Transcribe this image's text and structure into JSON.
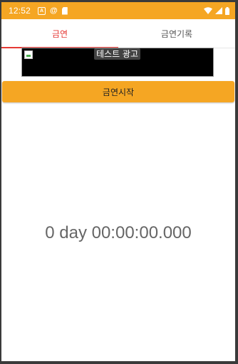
{
  "status_bar": {
    "time": "12:52",
    "background": "#f5a623",
    "left_icons": [
      "notification-a-icon",
      "at-sign-icon",
      "sd-card-icon"
    ],
    "right_icons": [
      "wifi-icon",
      "signal-icon",
      "battery-icon"
    ]
  },
  "tabs": [
    {
      "label": "금연",
      "active": true
    },
    {
      "label": "금연기록",
      "active": false
    }
  ],
  "ad": {
    "label": "테스트 광고"
  },
  "start_button": {
    "label": "금연시작"
  },
  "timer": {
    "text": "0 day 00:00:00.000"
  },
  "colors": {
    "accent": "#f5a623",
    "active_tab": "#e53935",
    "timer_text": "#666666"
  }
}
